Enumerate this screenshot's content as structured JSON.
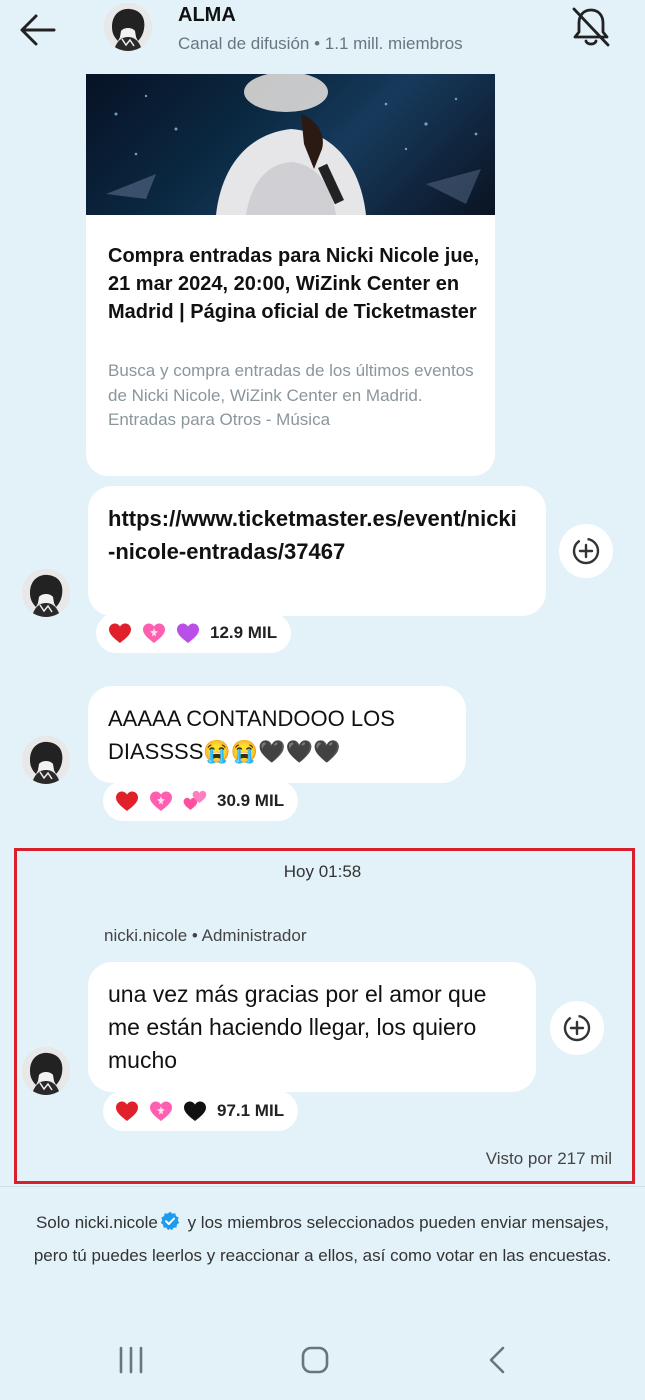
{
  "header": {
    "channel_name": "ALMA",
    "channel_info": "Canal de difusión • 1.1 mill. miembros",
    "icons": {
      "back": "arrow-left-icon",
      "mute": "bell-off-icon"
    }
  },
  "link_preview": {
    "title": "Compra entradas para Nicki Nicole jue, 21 mar 2024, 20:00, WiZink Center en Madrid | Página oficial de Ticketmaster",
    "description": "Busca y compra entradas de los últimos eventos de Nicki Nicole, WiZink Center en Madrid. Entradas para Otros - Música"
  },
  "messages": [
    {
      "text": "https://www.ticketmaster.es/event/nicki-nicole-entradas/37467",
      "reactions": [
        "red-heart",
        "pink-heart",
        "purple-heart"
      ],
      "reaction_count": "12.9 MIL"
    },
    {
      "text": "AAAAA CONTANDOOO LOS DIASSSS😭😭🖤🖤🖤",
      "reactions": [
        "red-heart",
        "pink-heart",
        "two-hearts"
      ],
      "reaction_count": "30.9 MIL"
    },
    {
      "timestamp": "Hoy 01:58",
      "sender": "nicki.nicole • Administrador",
      "text": "una vez más gracias por el amor que me están haciendo llegar, los quiero mucho",
      "reactions": [
        "red-heart",
        "pink-heart",
        "black-heart"
      ],
      "reaction_count": "97.1 MIL",
      "seen_by": "Visto por 217 mil"
    }
  ],
  "footer": {
    "before": "Solo nicki.nicole",
    "after": " y los miembros seleccionados pueden enviar mensajes, pero tú puedes leerlos y reaccionar a ellos, así como votar en las encuestas."
  },
  "colors": {
    "background": "#e3f2f9",
    "highlight_border": "#d6202b",
    "verified_badge": "#1d9bf0",
    "red_heart": "#e0202a",
    "pink_heart": "#ff5fb0",
    "purple_heart": "#b94ee8",
    "black_heart": "#111111"
  }
}
